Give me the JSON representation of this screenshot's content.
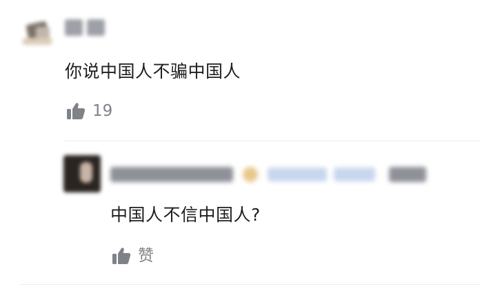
{
  "top_comment": {
    "text": "你说中国人不骗中国人",
    "like_count": "19"
  },
  "reply": {
    "text": "中国人不信中国人?",
    "like_label": "赞"
  },
  "icons": {
    "like": "thumbs-up-icon"
  },
  "colors": {
    "text": "#1e1e1e",
    "meta": "#7f8288",
    "divider": "#ececec"
  }
}
